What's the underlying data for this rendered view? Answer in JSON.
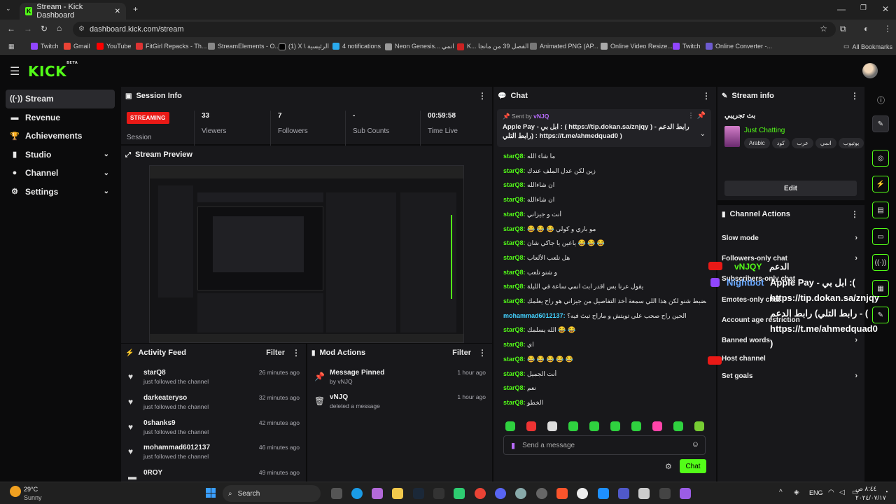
{
  "browser": {
    "tab_title": "Stream - Kick Dashboard",
    "url": "dashboard.kick.com/stream",
    "bookmarks": [
      "Twitch",
      "Gmail",
      "YouTube",
      "FitGirl Repacks - Th...",
      "StreamElements - O...",
      "(1) X \\ الرئيسية",
      "4 notifications",
      "Neon Genesis... انمي",
      "K... الفصل 39 من مانجا",
      "Animated PNG (AP...",
      "Online Video Resize...",
      "Twitch",
      "Online Converter -..."
    ],
    "all_bookmarks": "All Bookmarks"
  },
  "logo": {
    "text": "KICK",
    "sup": "BETA"
  },
  "sidebar": {
    "items": [
      {
        "label": "Stream",
        "icon": "radio-icon"
      },
      {
        "label": "Revenue",
        "icon": "wallet-icon"
      },
      {
        "label": "Achievements",
        "icon": "trophy-icon"
      },
      {
        "label": "Studio",
        "icon": "studio-icon"
      },
      {
        "label": "Channel",
        "icon": "user-icon"
      },
      {
        "label": "Settings",
        "icon": "gear-icon"
      }
    ]
  },
  "session": {
    "title": "Session Info",
    "status": "STREAMING",
    "status_label": "Session",
    "viewers": {
      "value": "33",
      "label": "Viewers"
    },
    "followers": {
      "value": "7",
      "label": "Followers"
    },
    "subs": {
      "value": "-",
      "label": "Sub Counts"
    },
    "time": {
      "value": "00:59:58",
      "label": "Time Live"
    }
  },
  "preview": {
    "title": "Stream Preview"
  },
  "activity": {
    "title": "Activity Feed",
    "filter": "Filter",
    "rows": [
      {
        "name": "starQ8",
        "sub": "just followed the channel",
        "time": "26 minutes ago"
      },
      {
        "name": "darkeateryso",
        "sub": "just followed the channel",
        "time": "32 minutes ago"
      },
      {
        "name": "0shanks9",
        "sub": "just followed the channel",
        "time": "42 minutes ago"
      },
      {
        "name": "mohammad6012137",
        "sub": "just followed the channel",
        "time": "46 minutes ago"
      },
      {
        "name": "0ROY",
        "sub": "",
        "time": "49 minutes ago"
      }
    ]
  },
  "mod": {
    "title": "Mod Actions",
    "filter": "Filter",
    "rows": [
      {
        "name": "Message Pinned",
        "sub": "by vNJQ",
        "time": "1 hour ago"
      },
      {
        "name": "vNJQ",
        "sub": "deleted a message",
        "time": "1 hour ago"
      }
    ]
  },
  "chat": {
    "title": "Chat",
    "pinned": {
      "sent_by": "Sent by",
      "user": "vNJQ",
      "line1": "Apple Pay - ابل بي : ( https://tip.dokan.sa/znjqy ) - رابط الدعم",
      "line2": "رابط التلي) : https://t.me/ahmedquad0 )"
    },
    "messages": [
      {
        "u": "starQ8",
        "m": "ما شاء الله"
      },
      {
        "u": "starQ8",
        "m": "زين لكن عدل الملف عندك"
      },
      {
        "u": "starQ8",
        "m": "ان شاءالله"
      },
      {
        "u": "starQ8",
        "m": "ان شاءالله"
      },
      {
        "u": "starQ8",
        "m": "أنت و جيزاني"
      },
      {
        "u": "starQ8",
        "m": "مو باري و كولي 😂 😂 😂"
      },
      {
        "u": "starQ8",
        "m": "😂 😂 😂 ياعين يا جاكي شان"
      },
      {
        "u": "starQ8",
        "m": "هل تلعب الألعاب"
      },
      {
        "u": "starQ8",
        "m": "و شنو تلعب"
      },
      {
        "u": "starQ8",
        "m": "يقول عرنا بس اقدر ابث انمي ساعة في الليلة"
      },
      {
        "u": "starQ8",
        "m": "ما ادري بضبط شنو لكن هذا اللي سمعة أخذ التفاصيل من جيزاني هو راح يعلمك"
      },
      {
        "u": "mohammad6012137",
        "m": "الحين راح صحب علي تويتش و ماراح تبث فيه؟"
      },
      {
        "u": "starQ8",
        "m": "😂 😂 الله يسلمك"
      },
      {
        "u": "starQ8",
        "m": "اي"
      },
      {
        "u": "starQ8",
        "m": "😂 😂 😂 😂 😂"
      },
      {
        "u": "starQ8",
        "m": "أنت الجميل"
      },
      {
        "u": "starQ8",
        "m": "نعم"
      },
      {
        "u": "starQ8",
        "m": "الخطو"
      }
    ],
    "placeholder": "Send a message",
    "send": "Chat"
  },
  "stream_info": {
    "title": "Stream info",
    "stream_title": "بث تجريبي",
    "category": "Just Chatting",
    "tags": [
      "Arabic",
      "كود",
      "عرب",
      "انمي",
      "يوتيوب"
    ],
    "edit": "Edit"
  },
  "channel_actions": {
    "title": "Channel Actions",
    "items": [
      "Slow mode",
      "Followers-only chat",
      "Subscribers-only chat",
      "Emotes-only chat",
      "Account age restriction",
      "Banned words",
      "Host channel",
      "Set goals"
    ]
  },
  "overlay": {
    "user1": "vNJQY",
    "user1_tag": "الدعم",
    "bot": "Nightbot",
    "bot_msg": "Apple Pay - ابل بي :(",
    "link1": "https://tip.dokan.sa/znjqy",
    "line2": "رابط التلي) رابط الدعم - (",
    "link2": "https://t.me/ahmedquad0",
    "close": ")"
  },
  "taskbar": {
    "weather_temp": "29°C",
    "weather_desc": "Sunny",
    "search": "Search",
    "lang": "ENG",
    "time": "٨:٤٤ ص",
    "date": "٢٠٢٤/٠٧/١٧"
  },
  "colors": {
    "accent": "#53fc18",
    "live": "#e91916",
    "panel": "#18181b",
    "bg": "#0b0b0c"
  }
}
